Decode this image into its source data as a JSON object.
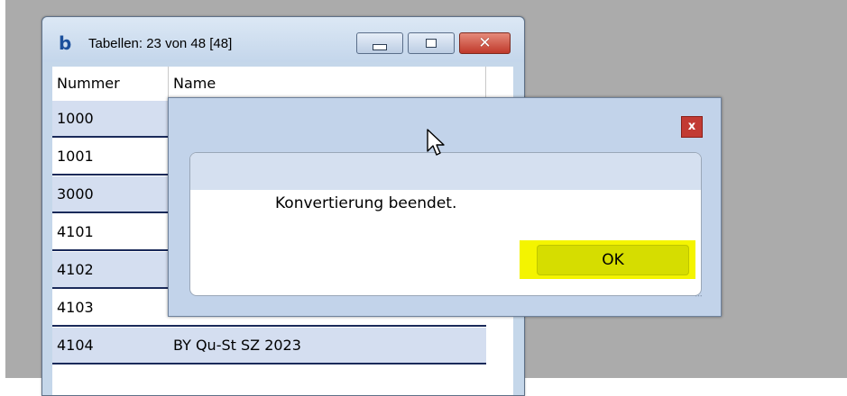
{
  "main_window": {
    "logo": "b",
    "title": "Tabellen: 23 von 48 [48]",
    "columns": [
      "Nummer",
      "Name"
    ],
    "rows": [
      {
        "nummer": "1000",
        "name": ""
      },
      {
        "nummer": "1001",
        "name": ""
      },
      {
        "nummer": "3000",
        "name": ""
      },
      {
        "nummer": "4101",
        "name": ""
      },
      {
        "nummer": "4102",
        "name": ""
      },
      {
        "nummer": "4103",
        "name": ""
      },
      {
        "nummer": "4104",
        "name": "BY Qu-St SZ 2023"
      }
    ],
    "caption_icons": [
      "minimize-icon",
      "maximize-icon",
      "close-icon"
    ]
  },
  "dialog": {
    "close_label": "x",
    "message": "Konvertierung beendet.",
    "ok_label": "OK"
  },
  "colors": {
    "ok_highlight": "#f4f400",
    "ok_button": "#d6dd00",
    "dialog_close": "#c23a33",
    "row_selected": "#d4def0"
  }
}
